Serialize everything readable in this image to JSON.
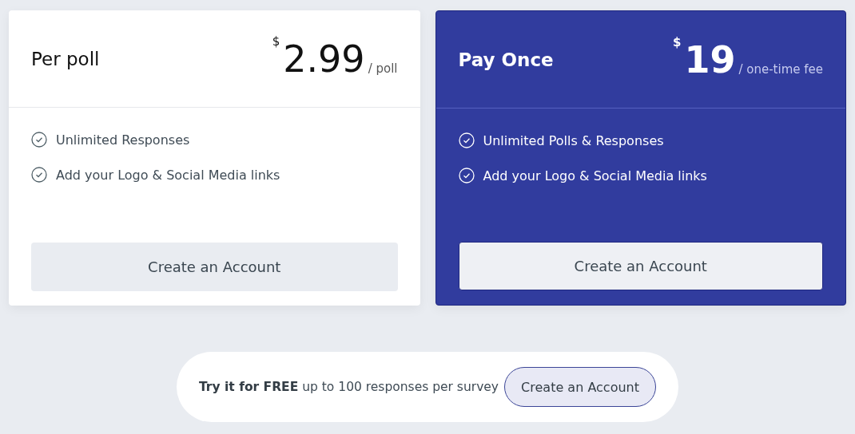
{
  "plans": [
    {
      "name": "Per poll",
      "currency": "$",
      "price": "2.99",
      "unit": "/ poll",
      "featured": false,
      "features": [
        "Unlimited Responses",
        "Add your Logo & Social Media links"
      ],
      "button": "Create an Account"
    },
    {
      "name": "Pay Once",
      "currency": "$",
      "price": "19",
      "unit": "/ one-time fee",
      "featured": true,
      "features": [
        "Unlimited Polls & Responses",
        "Add your Logo & Social Media links"
      ],
      "button": "Create an Account"
    }
  ],
  "trial": {
    "text": "**Try it for FREE** up to 100 responses per survey",
    "button": "Create an Account"
  }
}
